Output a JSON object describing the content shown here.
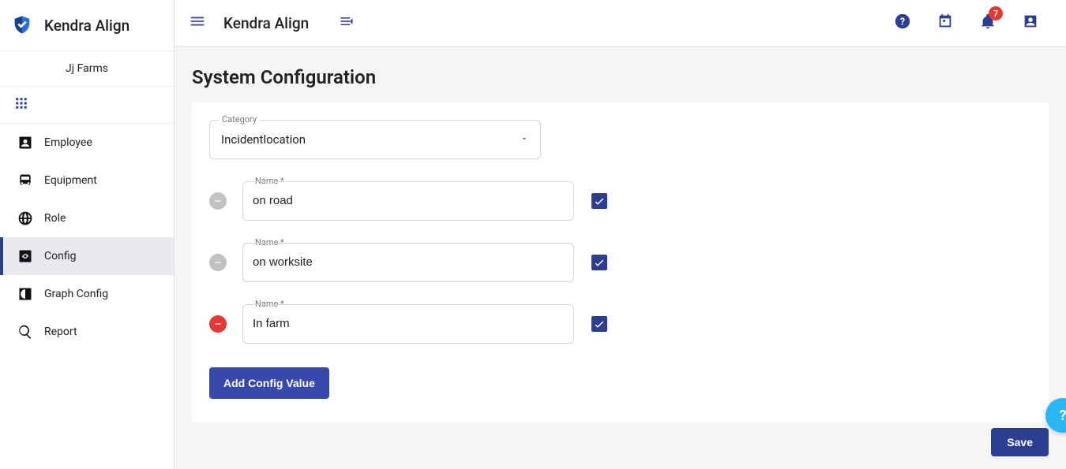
{
  "brand": {
    "name": "Kendra Align"
  },
  "tenant": {
    "name": "Jj Farms"
  },
  "header": {
    "title": "Kendra Align",
    "notification_count": "7"
  },
  "page": {
    "title": "System Configuration"
  },
  "sidebar": {
    "items": [
      {
        "id": "employee",
        "label": "Employee",
        "icon": "account-box-icon",
        "active": false
      },
      {
        "id": "equipment",
        "label": "Equipment",
        "icon": "bus-icon",
        "active": false
      },
      {
        "id": "role",
        "label": "Role",
        "icon": "globe-icon",
        "active": false
      },
      {
        "id": "config",
        "label": "Config",
        "icon": "gear-box-icon",
        "active": true
      },
      {
        "id": "graph-config",
        "label": "Graph Config",
        "icon": "contrast-box-icon",
        "active": false
      },
      {
        "id": "report",
        "label": "Report",
        "icon": "search-icon",
        "active": false
      }
    ]
  },
  "form": {
    "category_label": "Category",
    "category_value": "Incidentlocation",
    "name_label": "Name *",
    "rows": [
      {
        "value": "on road",
        "checked": true,
        "removable": false
      },
      {
        "value": "on worksite",
        "checked": true,
        "removable": false
      },
      {
        "value": "In farm",
        "checked": true,
        "removable": true
      }
    ],
    "add_button": "Add Config Value",
    "save_button": "Save"
  },
  "help_fab": "?"
}
